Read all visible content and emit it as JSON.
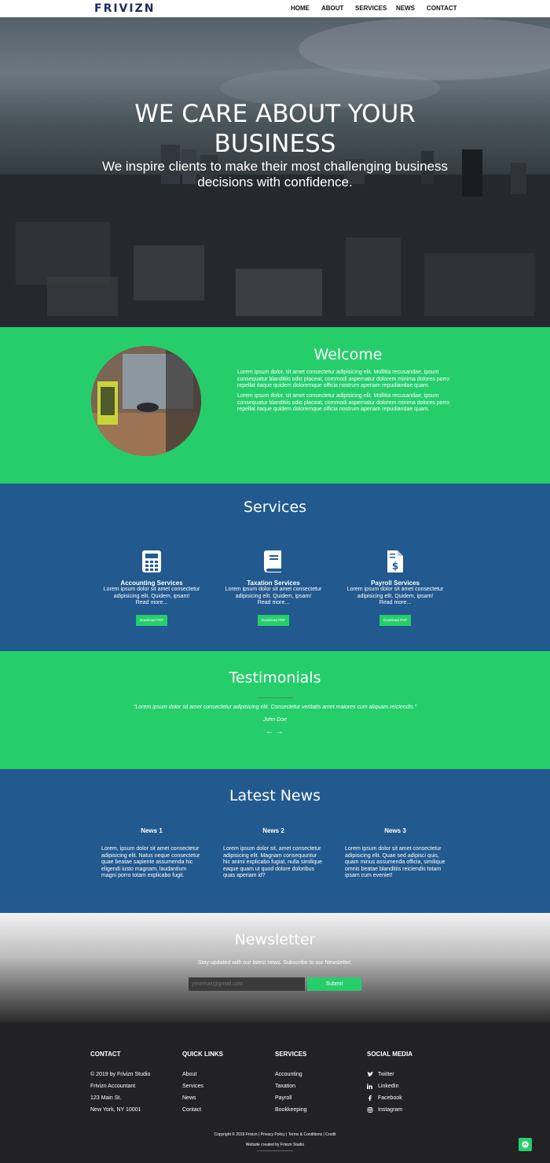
{
  "header": {
    "logo": "FRIVIZN",
    "nav": [
      "HOME",
      "ABOUT",
      "SERVICES",
      "NEWS",
      "CONTACT"
    ]
  },
  "hero": {
    "title_line1": "WE CARE ABOUT YOUR",
    "title_line2": "BUSINESS",
    "subtitle_line1": "We inspire clients to make their most challenging business",
    "subtitle_line2": "decisions with confidence."
  },
  "welcome": {
    "title": "Welcome",
    "paragraphs": [
      "Lorem ipsum dolor, sit amet consectetur adipisicing elit. Mollitia recusandae, ipsum consequatur blanditiis odio placeat, commodi aspernatur dolorem minima dolores porro repellat itaque quidem doloremque officia nostrum aperiam repudiandae quam.",
      "Lorem ipsum dolor, sit amet consectetur adipisicing elit. Mollitia recusandae, ipsum consequatur blanditiis odio placeat, commodi aspernatur dolorem minima dolores porro repellat itaque quidem doloremque officia nostrum aperiam repudiandae quam."
    ]
  },
  "services": {
    "title": "Services",
    "items": [
      {
        "icon": "calculator-icon",
        "title": "Accounting Services",
        "text": "Lorem ipsum dolor sit amet consectetur adipisicing elit. Quidem, ipsam!",
        "more": "Read more...",
        "button": "Download PDF"
      },
      {
        "icon": "book-icon",
        "title": "Taxation Services",
        "text": "Lorem ipsum dolor sit amet consectetur adipisicing elit. Quidem, ipsam!",
        "more": "Read more...",
        "button": "Download PDF"
      },
      {
        "icon": "invoice-dollar-icon",
        "title": "Payroll Services",
        "text": "Lorem ipsum dolor sit amet consectetur adipisicing elit. Quidem, ipsam!",
        "more": "Read more...",
        "button": "Download PDF"
      }
    ]
  },
  "testimonials": {
    "title": "Testimonials",
    "quote": "\"Lorem ipsum dolor sit amet consectetur adipisicing elit. Consectetur veritatis amet maiores cum aliquam reiciendis.\"",
    "author": "John Doe",
    "prev": "←",
    "next": "→"
  },
  "news": {
    "title": "Latest News",
    "items": [
      {
        "title": "News 1",
        "text": "Lorem, ipsum dolor sit amet consectetur adipisicing elit. Natus neque consectetur quae beatae sapiente assumenda hic eligendi iusto magnam, laudantium magni porro totam explicabo fugit."
      },
      {
        "title": "News 2",
        "text": "Lorem ipsum dolor sit, amet consectetur adipisicing elit. Magnam consequuntur hic animi explicabo fugiat, nulla similique eaque quam ut quod dolore doloribus quas aperiam id?"
      },
      {
        "title": "News 3",
        "text": "Lorem ipsum dolor sit amet consectetur adipisicing elit. Quae sed adipisci quis, quam minus assumenda officia, similique omnis beatae blanditiis reiciendis totam ipsam cum eveniet!"
      }
    ]
  },
  "newsletter": {
    "title": "Newsletter",
    "text": "Stay updated with our latest news. Subscribe to our Newsletter.",
    "placeholder": "yourmail@gmail.com",
    "button": "Submit"
  },
  "footer": {
    "contact": {
      "title": "CONTACT",
      "lines": [
        "© 2019 by Frivizn Studio",
        "Frivizn Accountant",
        "123 Main St.",
        "New York, NY 10001"
      ]
    },
    "quick_links": {
      "title": "QUICK LINKS",
      "links": [
        "About",
        "Services",
        "News",
        "Contact"
      ]
    },
    "services": {
      "title": "SERVICES",
      "links": [
        "Accounting",
        "Taxation",
        "Payroll",
        "Bookkeeping"
      ]
    },
    "social": {
      "title": "SOCIAL MEDIA",
      "links": [
        {
          "icon": "twitter-icon",
          "label": "Twitter"
        },
        {
          "icon": "linkedin-icon",
          "label": "LinkedIn"
        },
        {
          "icon": "facebook-icon",
          "label": "Facebook"
        },
        {
          "icon": "instagram-icon",
          "label": "Instagram"
        }
      ]
    },
    "copyright": "Copyright © 2019 Frivizn | Privacy Policy | Terms & Conditions | Credit",
    "credit": "Website created by Frivizn Studio"
  },
  "colors": {
    "green": "#26ce6b",
    "blue": "#225a8f",
    "dark": "#222224",
    "logo": "#1b2b5e"
  }
}
